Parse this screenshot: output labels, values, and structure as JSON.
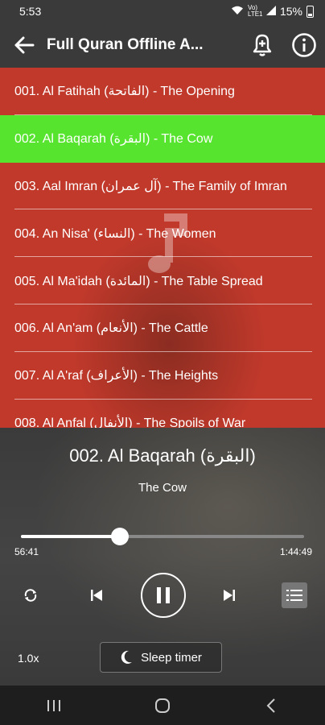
{
  "status": {
    "time": "5:53",
    "battery": "15%",
    "signal_label": "Vo) LTE1"
  },
  "appbar": {
    "title": "Full Quran Offline A..."
  },
  "surahs": [
    "001. Al Fatihah (الفاتحة) - The Opening",
    "002. Al Baqarah (البقرة) - The Cow",
    "003. Aal Imran (آل عمران) - The Family of Imran",
    "004. An Nisa' (النساء) - The Women",
    "005. Al Ma'idah (المائدة) - The Table Spread",
    "006. Al An'am (الأنعام) - The Cattle",
    "007. Al A'raf (الأعراف) - The Heights",
    "008. Al Anfal (الأنفال) - The Spoils of War"
  ],
  "active_index": 1,
  "player": {
    "title": "002. Al Baqarah (البقرة)",
    "subtitle": "The Cow",
    "elapsed": "56:41",
    "total": "1:44:49",
    "progress": 0.35,
    "speed": "1.0x",
    "sleep_label": "Sleep timer"
  },
  "colors": {
    "list_bg": "#c0392b",
    "active_bg": "#57e42e",
    "bar_bg": "#3a3a3a"
  },
  "icons": [
    "back-arrow-icon",
    "bell-add-icon",
    "info-icon",
    "repeat-icon",
    "skip-previous-icon",
    "pause-icon",
    "skip-next-icon",
    "queue-list-icon",
    "moon-icon",
    "recents-icon",
    "home-icon",
    "nav-back-icon"
  ]
}
